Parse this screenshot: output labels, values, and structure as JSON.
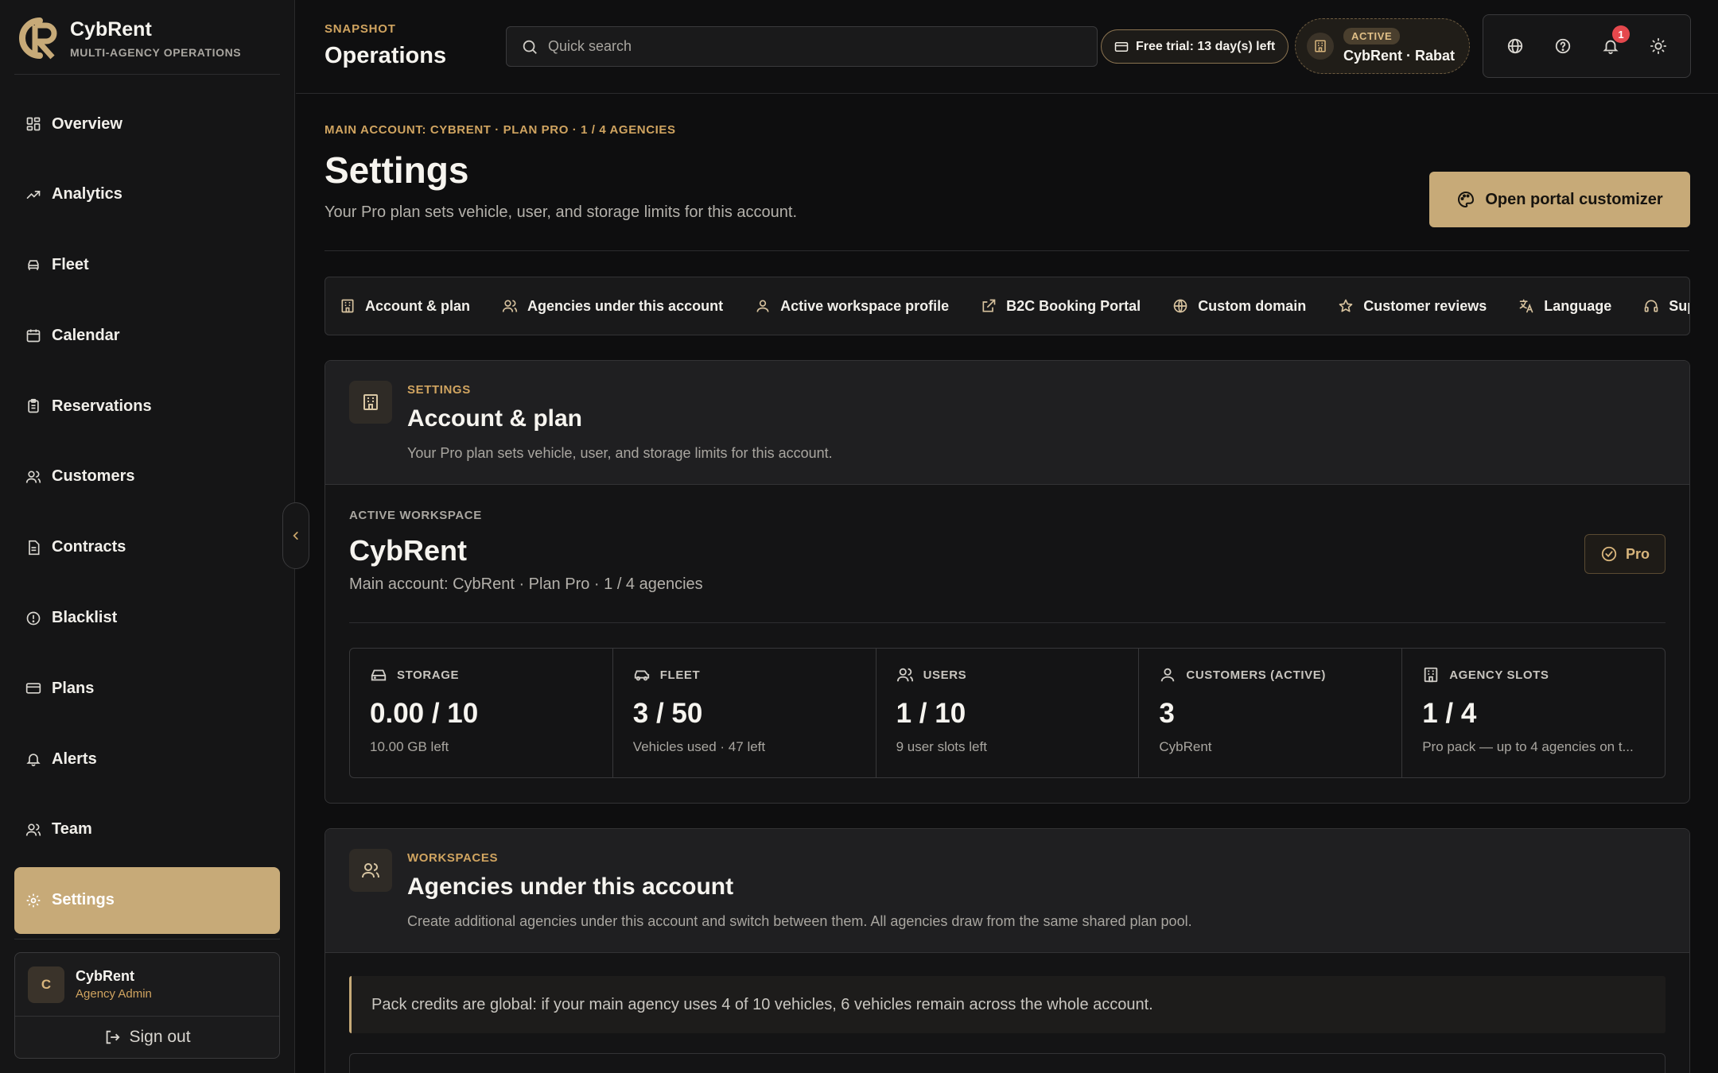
{
  "brand": {
    "name": "CybRent",
    "subtitle": "MULTI-AGENCY OPERATIONS",
    "accent": "#c7aa78"
  },
  "sidebar": {
    "items": [
      {
        "label": "Overview",
        "icon": "grid-icon"
      },
      {
        "label": "Analytics",
        "icon": "trend-icon"
      },
      {
        "label": "Fleet",
        "icon": "car-icon"
      },
      {
        "label": "Calendar",
        "icon": "calendar-icon"
      },
      {
        "label": "Reservations",
        "icon": "clipboard-icon"
      },
      {
        "label": "Customers",
        "icon": "users-icon"
      },
      {
        "label": "Contracts",
        "icon": "document-icon"
      },
      {
        "label": "Blacklist",
        "icon": "alert-circle-icon"
      },
      {
        "label": "Plans",
        "icon": "card-icon"
      },
      {
        "label": "Alerts",
        "icon": "bell-icon"
      },
      {
        "label": "Team",
        "icon": "team-icon"
      },
      {
        "label": "Settings",
        "icon": "gear-icon",
        "active": true
      }
    ],
    "user": {
      "initial": "C",
      "name": "CybRent",
      "role": "Agency Admin"
    },
    "signout_label": "Sign out"
  },
  "topbar": {
    "eyebrow": "SNAPSHOT",
    "title": "Operations",
    "search_placeholder": "Quick search",
    "trial_label": "Free trial: 13 day(s) left",
    "workspace_badge": "ACTIVE",
    "workspace_name": "CybRent · Rabat",
    "notification_count": "1"
  },
  "page": {
    "eyebrow": "MAIN ACCOUNT: CYBRENT · PLAN PRO · 1 / 4 AGENCIES",
    "title": "Settings",
    "subtitle": "Your Pro plan sets vehicle, user, and storage limits for this account.",
    "customizer_label": "Open portal customizer"
  },
  "tabs": [
    {
      "label": "Account & plan",
      "icon": "building-icon"
    },
    {
      "label": "Agencies under this account",
      "icon": "users-icon"
    },
    {
      "label": "Active workspace profile",
      "icon": "user-icon"
    },
    {
      "label": "B2C Booking Portal",
      "icon": "external-link-icon"
    },
    {
      "label": "Custom domain",
      "icon": "globe-icon"
    },
    {
      "label": "Customer reviews",
      "icon": "star-icon"
    },
    {
      "label": "Language",
      "icon": "translate-icon"
    },
    {
      "label": "Support",
      "icon": "headphones-icon"
    }
  ],
  "account_card": {
    "eyebrow": "SETTINGS",
    "title": "Account & plan",
    "subtitle": "Your Pro plan sets vehicle, user, and storage limits for this account.",
    "workspace_eyebrow": "ACTIVE WORKSPACE",
    "workspace_name": "CybRent",
    "workspace_sub": "Main account: CybRent · Plan Pro · 1 / 4 agencies",
    "plan_badge": "Pro",
    "stats": [
      {
        "label": "STORAGE",
        "value": "0.00 / 10",
        "note": "10.00 GB left",
        "icon": "storage-icon"
      },
      {
        "label": "FLEET",
        "value": "3 / 50",
        "note": "Vehicles used · 47 left",
        "icon": "car-icon"
      },
      {
        "label": "USERS",
        "value": "1 / 10",
        "note": "9 user slots left",
        "icon": "users-icon"
      },
      {
        "label": "CUSTOMERS (ACTIVE)",
        "value": "3",
        "note": "CybRent",
        "icon": "user-icon"
      },
      {
        "label": "AGENCY SLOTS",
        "value": "1 / 4",
        "note": "Pro pack — up to 4 agencies on t...",
        "icon": "building-icon"
      }
    ]
  },
  "agencies_card": {
    "eyebrow": "WORKSPACES",
    "title": "Agencies under this account",
    "subtitle": "Create additional agencies under this account and switch between them. All agencies draw from the same shared plan pool.",
    "callout": "Pack credits are global: if your main agency uses 4 of 10 vehicles, 6 vehicles remain across the whole account."
  }
}
